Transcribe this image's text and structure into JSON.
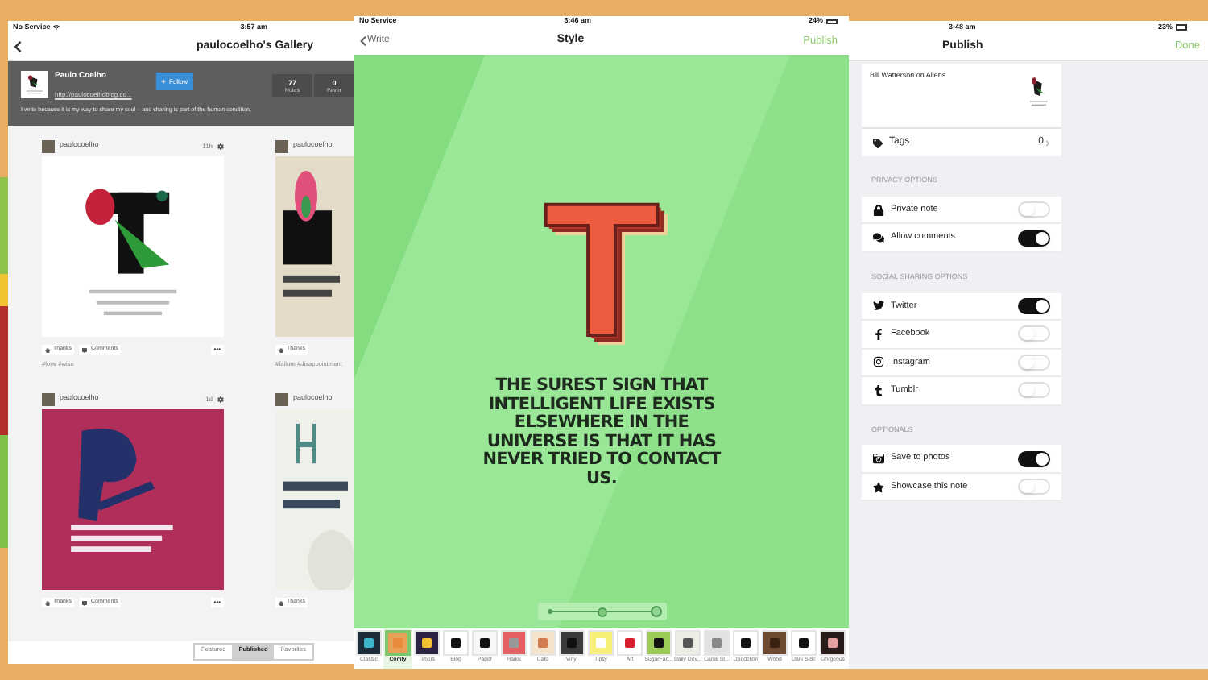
{
  "gallery": {
    "status_bar": {
      "carrier": "No Service",
      "time": "3:57 am"
    },
    "title": "paulocoelho's Gallery",
    "profile": {
      "name": "Paulo Coelho",
      "link": "http://paulocoelhoblog.co...",
      "follow": "Follow",
      "stats": [
        {
          "value": "77",
          "label": "Notes"
        },
        {
          "value": "0",
          "label": "Favor"
        }
      ],
      "bio": "I write because it is my way to share my soul – and sharing is part of the human condition."
    },
    "notes": [
      {
        "author": "paulocoelho",
        "age": "11h",
        "thanks": "Thanks",
        "comments": "Comments",
        "more": "•••",
        "tags": "#love #wise"
      },
      {
        "author": "paulocoelho",
        "thanks": "Thanks",
        "tags": "#failure #disappointment"
      },
      {
        "author": "paulocoelho",
        "age": "1d",
        "thanks": "Thanks",
        "comments": "Comments",
        "more": "•••"
      },
      {
        "author": "paulocoelho",
        "thanks": "Thanks"
      }
    ],
    "tabs": [
      {
        "label": "Featured",
        "selected": false
      },
      {
        "label": "Published",
        "selected": true
      },
      {
        "label": "Favorites",
        "selected": false
      }
    ]
  },
  "style": {
    "status_bar": {
      "carrier": "No Service",
      "time": "3:46 am",
      "battery": "24%"
    },
    "back": "Write",
    "title": "Style",
    "action": "Publish",
    "preview": {
      "initial": "T",
      "quote": "THE SUREST SIGN THAT INTELLIGENT LIFE EXISTS ELSEWHERE IN THE UNIVERSE IS THAT IT HAS NEVER TRIED TO CONTACT US.",
      "size_slider": {
        "level": 1
      }
    },
    "styles": [
      {
        "label": "Classic",
        "selected": false,
        "color": "#1c2b36"
      },
      {
        "label": "Comfy",
        "selected": true,
        "color": "#e99f55"
      },
      {
        "label": "Timers",
        "selected": false,
        "color": "#2b2140"
      },
      {
        "label": "Blog",
        "selected": false,
        "color": "#ffffff"
      },
      {
        "label": "Paper",
        "selected": false,
        "color": "#f7f7f7"
      },
      {
        "label": "Haiku",
        "selected": false,
        "color": "#e46060"
      },
      {
        "label": "Cafe",
        "selected": false,
        "color": "#f3e2cc"
      },
      {
        "label": "Vinyl",
        "selected": false,
        "color": "#3b3b3b"
      },
      {
        "label": "Tipsy",
        "selected": false,
        "color": "#f6ef78"
      },
      {
        "label": "Art",
        "selected": false,
        "color": "#ffffff"
      },
      {
        "label": "SugarFac...",
        "selected": false,
        "color": "#9ccc55"
      },
      {
        "label": "Daily Dev...",
        "selected": false,
        "color": "#ecebe4"
      },
      {
        "label": "Canal St...",
        "selected": false,
        "color": "#e2e2e2"
      },
      {
        "label": "Dandelion",
        "selected": false,
        "color": "#ffffff"
      },
      {
        "label": "Wood",
        "selected": false,
        "color": "#6e4b31"
      },
      {
        "label": "Dark Side",
        "selected": false,
        "color": "#ffffff"
      },
      {
        "label": "Gorgeous",
        "selected": false,
        "color": "#2a1b1b"
      }
    ]
  },
  "publish": {
    "status_bar": {
      "time": "3:48 am",
      "battery": "23%"
    },
    "title": "Publish",
    "action": "Done",
    "note": {
      "title": "Bill Watterson on Aliens",
      "tags_label": "Tags",
      "tags_count": "0"
    },
    "sections": [
      {
        "heading": "PRIVACY OPTIONS",
        "rows": [
          {
            "label": "Private note",
            "on": false
          },
          {
            "label": "Allow comments",
            "on": true
          }
        ]
      },
      {
        "heading": "SOCIAL SHARING OPTIONS",
        "rows": [
          {
            "label": "Twitter",
            "on": true
          },
          {
            "label": "Facebook",
            "on": false
          },
          {
            "label": "Instagram",
            "on": false
          },
          {
            "label": "Tumblr",
            "on": false
          }
        ]
      },
      {
        "heading": "OPTIONALS",
        "rows": [
          {
            "label": "Save to photos",
            "on": true
          },
          {
            "label": "Showcase this note",
            "on": false
          }
        ]
      }
    ]
  }
}
